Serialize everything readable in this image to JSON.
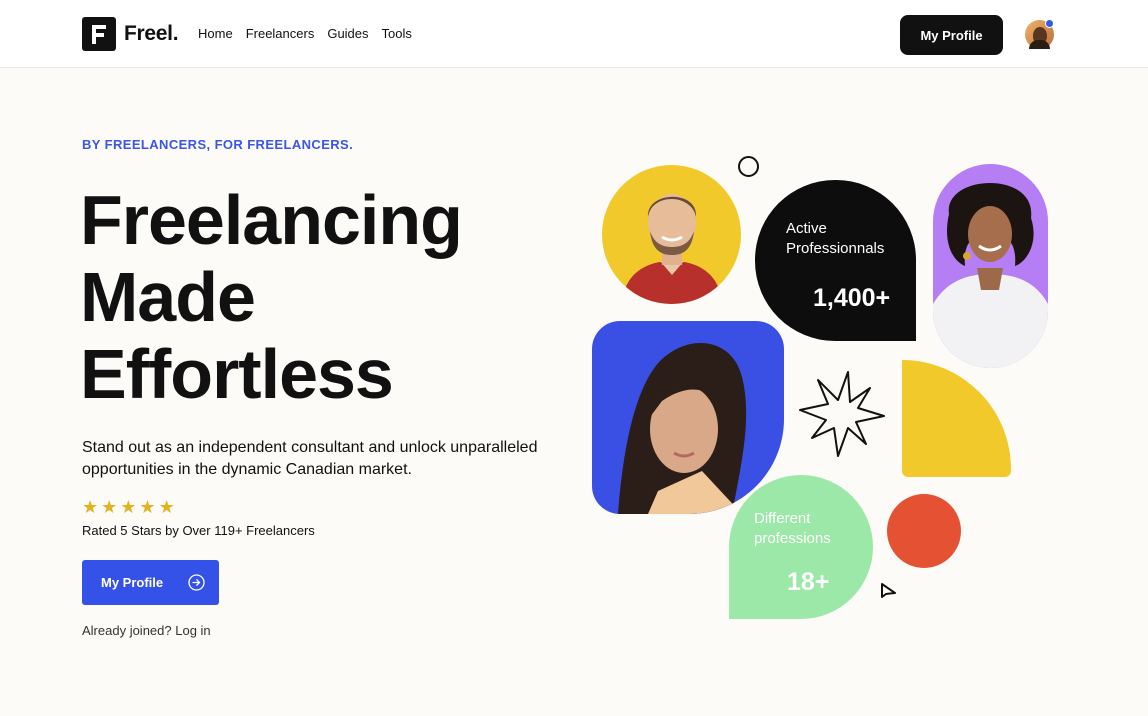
{
  "header": {
    "logo_text": "Freel",
    "logo_dot": ".",
    "nav": [
      "Home",
      "Freelancers",
      "Guides",
      "Tools"
    ],
    "profile_button": "My Profile"
  },
  "hero": {
    "eyebrow": "BY FREELANCERS, FOR FREELANCERS.",
    "headline_lines": [
      "Freelancing",
      "Made",
      "Effortless"
    ],
    "subtext": "Stand out as an independent consultant and unlock unparalleled opportunities in the dynamic Canadian market.",
    "stars": [
      "★",
      "★",
      "★",
      "★",
      "★"
    ],
    "rating": 5,
    "rated_text": "Rated 5 Stars by Over 119+ Freelancers",
    "cta_label": "My Profile",
    "login_text": "Already joined? Log in"
  },
  "stats": {
    "active_label_1": "Active",
    "active_label_2": "Professionnals",
    "active_value": "1,400+",
    "prof_label_1": "Different",
    "prof_label_2": "professions",
    "prof_value": "18+"
  },
  "colors": {
    "accent": "#3451e8",
    "yellow": "#f1c92a",
    "purple": "#b57ef4",
    "green": "#9ce8a8",
    "red": "#e55233",
    "background": "#fcfbf8"
  }
}
